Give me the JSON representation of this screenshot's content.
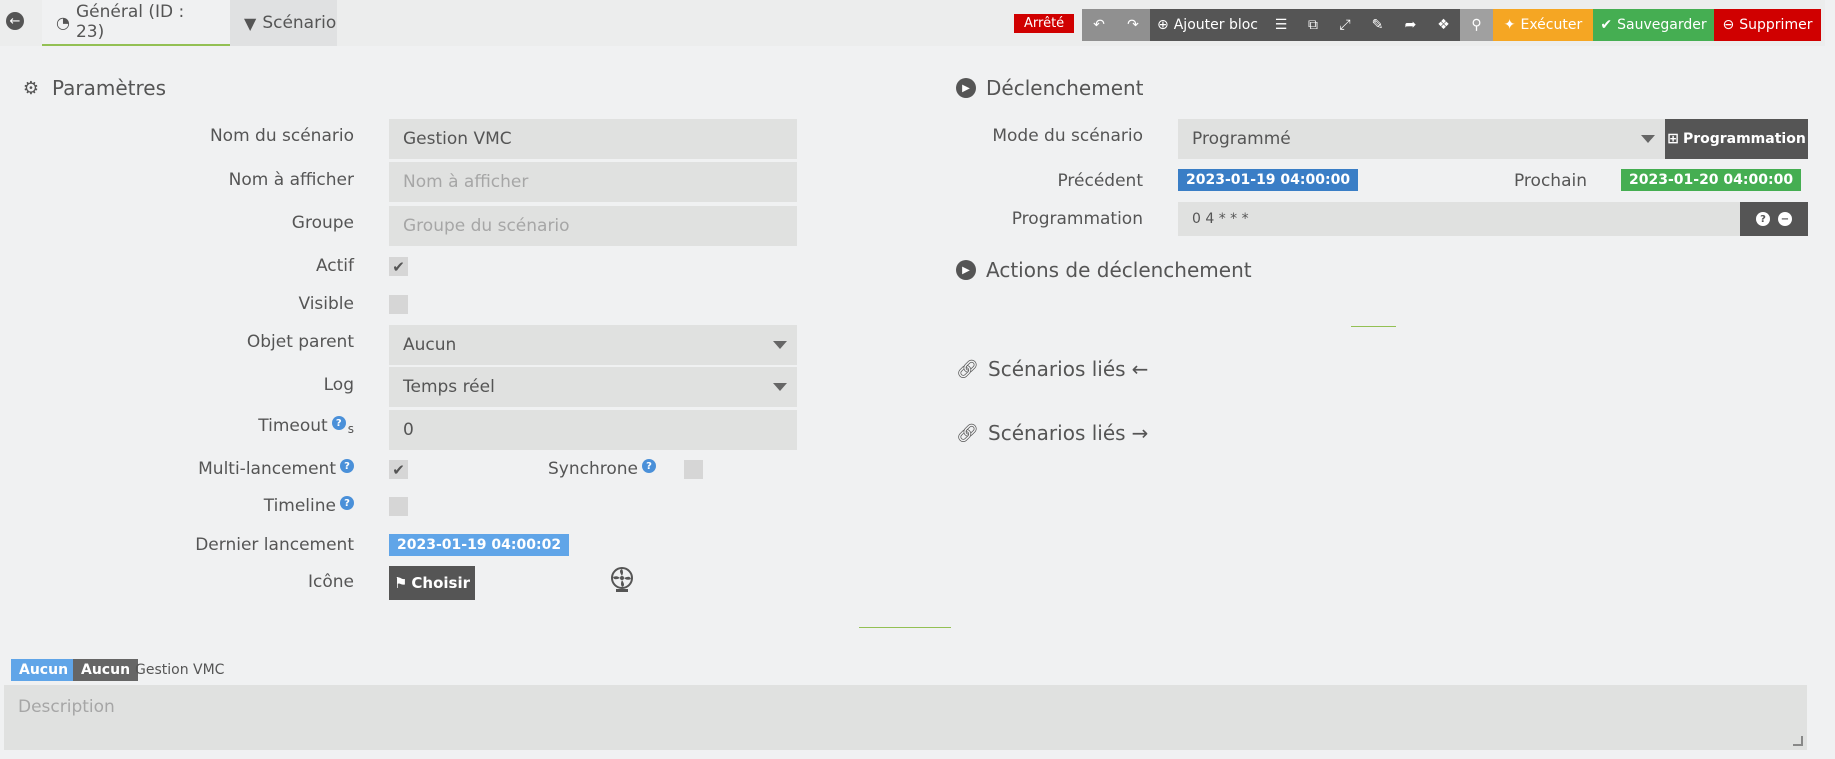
{
  "tabs": {
    "general": "Général (ID : 23)",
    "scenario": "Scénario"
  },
  "toolbar": {
    "status": "Arrêté",
    "add_block": "Ajouter bloc",
    "execute": "Exécuter",
    "save": "Sauvegarder",
    "delete": "Supprimer"
  },
  "params": {
    "title": "Paramètres",
    "name_label": "Nom du scénario",
    "name_value": "Gestion VMC",
    "display_label": "Nom à afficher",
    "display_placeholder": "Nom à afficher",
    "group_label": "Groupe",
    "group_placeholder": "Groupe du scénario",
    "active_label": "Actif",
    "visible_label": "Visible",
    "parent_label": "Objet parent",
    "parent_value": "Aucun",
    "log_label": "Log",
    "log_value": "Temps réel",
    "timeout_label": "Timeout",
    "timeout_unit": "s",
    "timeout_value": "0",
    "multi_label": "Multi-lancement",
    "sync_label": "Synchrone",
    "timeline_label": "Timeline",
    "last_label": "Dernier lancement",
    "last_value": "2023-01-19 04:00:02",
    "icon_label": "Icône",
    "icon_button": "Choisir"
  },
  "trigger": {
    "title": "Déclenchement",
    "mode_label": "Mode du scénario",
    "mode_value": "Programmé",
    "prog_button": "Programmation",
    "prev_label": "Précédent",
    "prev_value": "2023-01-19 04:00:00",
    "next_label": "Prochain",
    "next_value": "2023-01-20 04:00:00",
    "schedule_label": "Programmation",
    "schedule_value": "0 4 * * *",
    "actions_title": "Actions de déclenchement",
    "linked_in": "Scénarios liés",
    "linked_out": "Scénarios liés"
  },
  "footer": {
    "tag1": "Aucun",
    "tag2": "Aucun",
    "name": "Gestion VMC",
    "description_placeholder": "Description"
  }
}
